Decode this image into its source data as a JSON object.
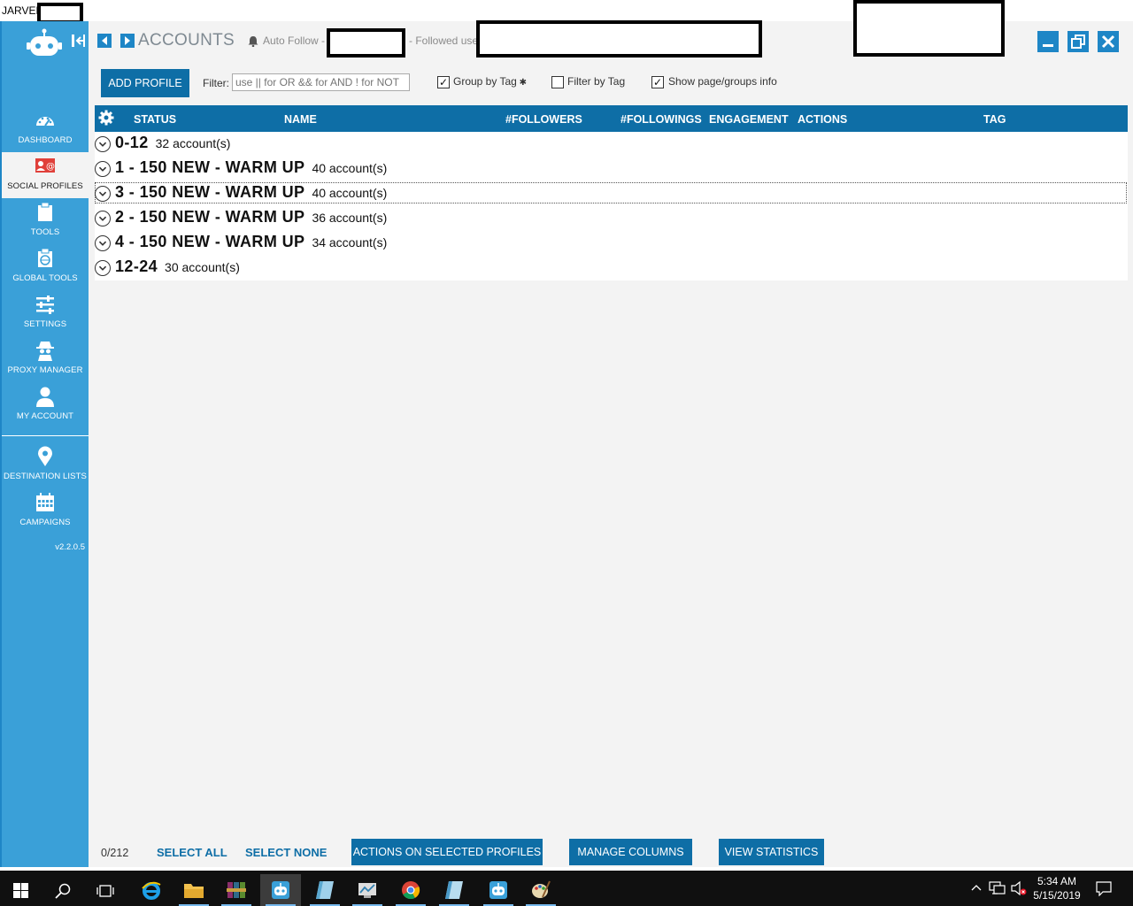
{
  "app": {
    "title": "JARVEE"
  },
  "sidebar": {
    "version": "v2.2.0.5",
    "items": [
      {
        "label": "DASHBOARD"
      },
      {
        "label": "SOCIAL PROFILES"
      },
      {
        "label": "TOOLS"
      },
      {
        "label": "GLOBAL TOOLS"
      },
      {
        "label": "SETTINGS"
      },
      {
        "label": "PROXY MANAGER"
      },
      {
        "label": "MY ACCOUNT"
      },
      {
        "label": "DESTINATION LISTS"
      },
      {
        "label": "CAMPAIGNS"
      }
    ],
    "active": "SOCIAL PROFILES"
  },
  "header": {
    "title": "ACCOUNTS",
    "auto_follow": "Auto Follow -",
    "followed": "- Followed use"
  },
  "toolbar": {
    "add_profile": "ADD PROFILE",
    "filter_label": "Filter:",
    "filter_placeholder": "use || for OR && for AND ! for NOT",
    "group_by_tag": "Group by Tag",
    "group_by_tag_checked": true,
    "filter_by_tag": "Filter by Tag",
    "filter_by_tag_checked": false,
    "show_page_info": "Show page/groups info",
    "show_page_info_checked": true
  },
  "table": {
    "columns": [
      "STATUS",
      "NAME",
      "#FOLLOWERS",
      "#FOLLOWINGS",
      "ENGAGEMENT",
      "ACTIONS",
      "TAG"
    ],
    "groups": [
      {
        "name": "0-12",
        "count": "32 account(s)"
      },
      {
        "name": "1 - 150 NEW - WARM UP",
        "count": "40 account(s)"
      },
      {
        "name": "3 - 150 NEW - WARM UP",
        "count": "40 account(s)"
      },
      {
        "name": "2 - 150 NEW - WARM UP",
        "count": "36 account(s)"
      },
      {
        "name": "4 - 150 NEW - WARM UP",
        "count": "34 account(s)"
      },
      {
        "name": "12-24",
        "count": "30 account(s)"
      }
    ],
    "focused_group": "3 - 150 NEW - WARM UP"
  },
  "footer": {
    "selected": "0/212",
    "select_all": "SELECT ALL",
    "select_none": "SELECT NONE",
    "actions_selected": "ACTIONS ON SELECTED PROFILES",
    "manage_columns": "MANAGE COLUMNS",
    "view_statistics": "VIEW STATISTICS"
  },
  "taskbar": {
    "time": "5:34 AM",
    "date": "5/15/2019"
  },
  "colors": {
    "sidebar": "#3aa0d8",
    "primary": "#0e6ea6",
    "content_bg": "#f3f3f3"
  }
}
